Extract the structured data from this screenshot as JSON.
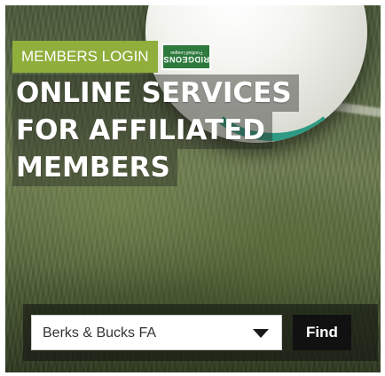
{
  "login": {
    "label": "MEMBERS LOGIN",
    "sponsor_logo": {
      "name": "RIDGEONS",
      "subtitle": "Football League",
      "color": "#2d7a3c"
    },
    "accent_color": "#8fae3c"
  },
  "headline": {
    "lines": [
      "ONLINE SERVICES",
      "FOR AFFILIATED",
      "MEMBERS"
    ]
  },
  "search": {
    "selected_value": "Berks & Bucks FA",
    "dropdown_icon": "caret-down-icon",
    "find_label": "Find"
  }
}
